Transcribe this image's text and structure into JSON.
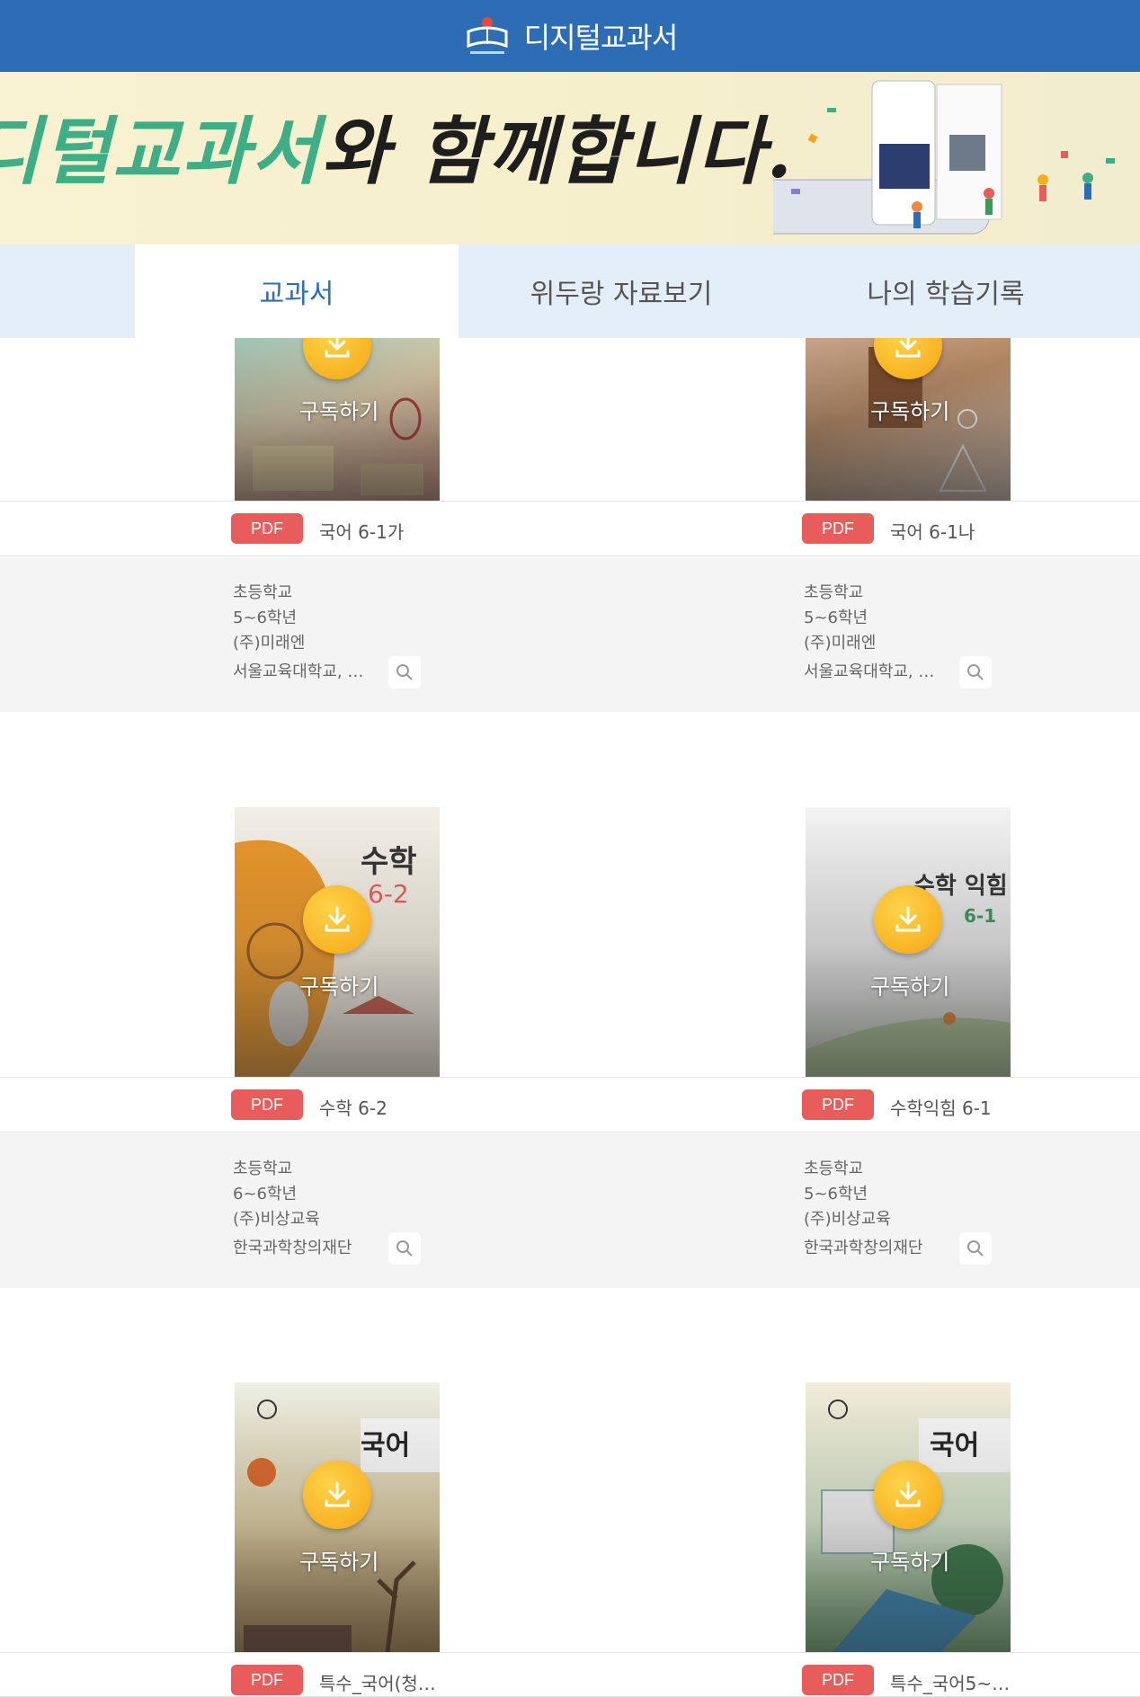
{
  "header": {
    "app_title": "디지털교과서",
    "logo_icon": "digital-textbook-logo-icon",
    "accent_color": "#2d6db6"
  },
  "banner": {
    "text_green": "디털교과서",
    "text_dark": "와 함께합니다."
  },
  "tabs": [
    {
      "label": "교과서",
      "active": true
    },
    {
      "label": "위두랑 자료보기",
      "active": false
    },
    {
      "label": "나의 학습기록",
      "active": false
    }
  ],
  "books": [
    {
      "title": "국어 6-1가",
      "badge": "PDF",
      "school": "초등학교",
      "grade": "5~6학년",
      "publisher": "(주)미래엔",
      "author": "서울교육대학교, …",
      "subscribe_label": "구독하기"
    },
    {
      "title": "국어 6-1나",
      "badge": "PDF",
      "school": "초등학교",
      "grade": "5~6학년",
      "publisher": "(주)미래엔",
      "author": "서울교육대학교, …",
      "subscribe_label": "구독하기"
    },
    {
      "title": "수학 6-2",
      "badge": "PDF",
      "school": "초등학교",
      "grade": "6~6학년",
      "publisher": "(주)비상교육",
      "author": "한국과학창의재단",
      "subscribe_label": "구독하기"
    },
    {
      "title": "수학익힘 6-1",
      "badge": "PDF",
      "school": "초등학교",
      "grade": "5~6학년",
      "publisher": "(주)비상교육",
      "author": "한국과학창의재단",
      "subscribe_label": "구독하기"
    },
    {
      "title": "특수_국어(청…",
      "badge": "PDF",
      "subscribe_label": "구독하기"
    },
    {
      "title": "특수_국어5~…",
      "badge": "PDF",
      "subscribe_label": "구독하기"
    }
  ],
  "colors": {
    "pdf_badge": "#e85c5c",
    "download_button": "#f5a614"
  }
}
